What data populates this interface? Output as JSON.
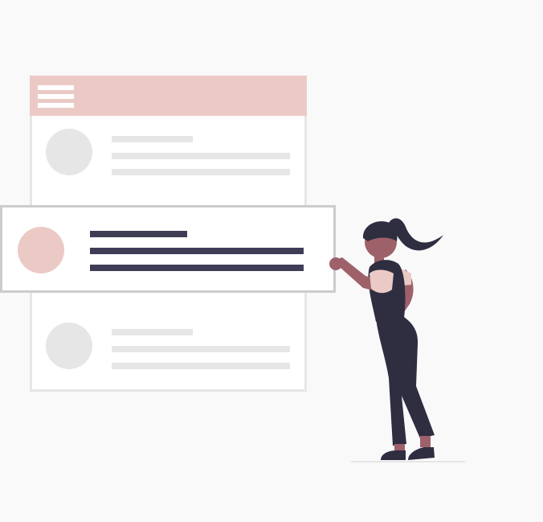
{
  "colors": {
    "background": "#f9f9f9",
    "card": "#ffffff",
    "card_border": "#e6e6e6",
    "highlight_border": "#cccccc",
    "accent": "#ebcac6",
    "skeleton_light": "#e6e6e6",
    "skeleton_dark": "#3f3d56",
    "figure_dark": "#2f2e41",
    "skin": "#9e616a",
    "shirt_accent": "#ebcac6"
  },
  "icons": {
    "menu": "hamburger-icon",
    "figure": "person-figure"
  },
  "list": {
    "rows": [
      {
        "state": "default"
      },
      {
        "state": "selected"
      },
      {
        "state": "default"
      }
    ]
  }
}
